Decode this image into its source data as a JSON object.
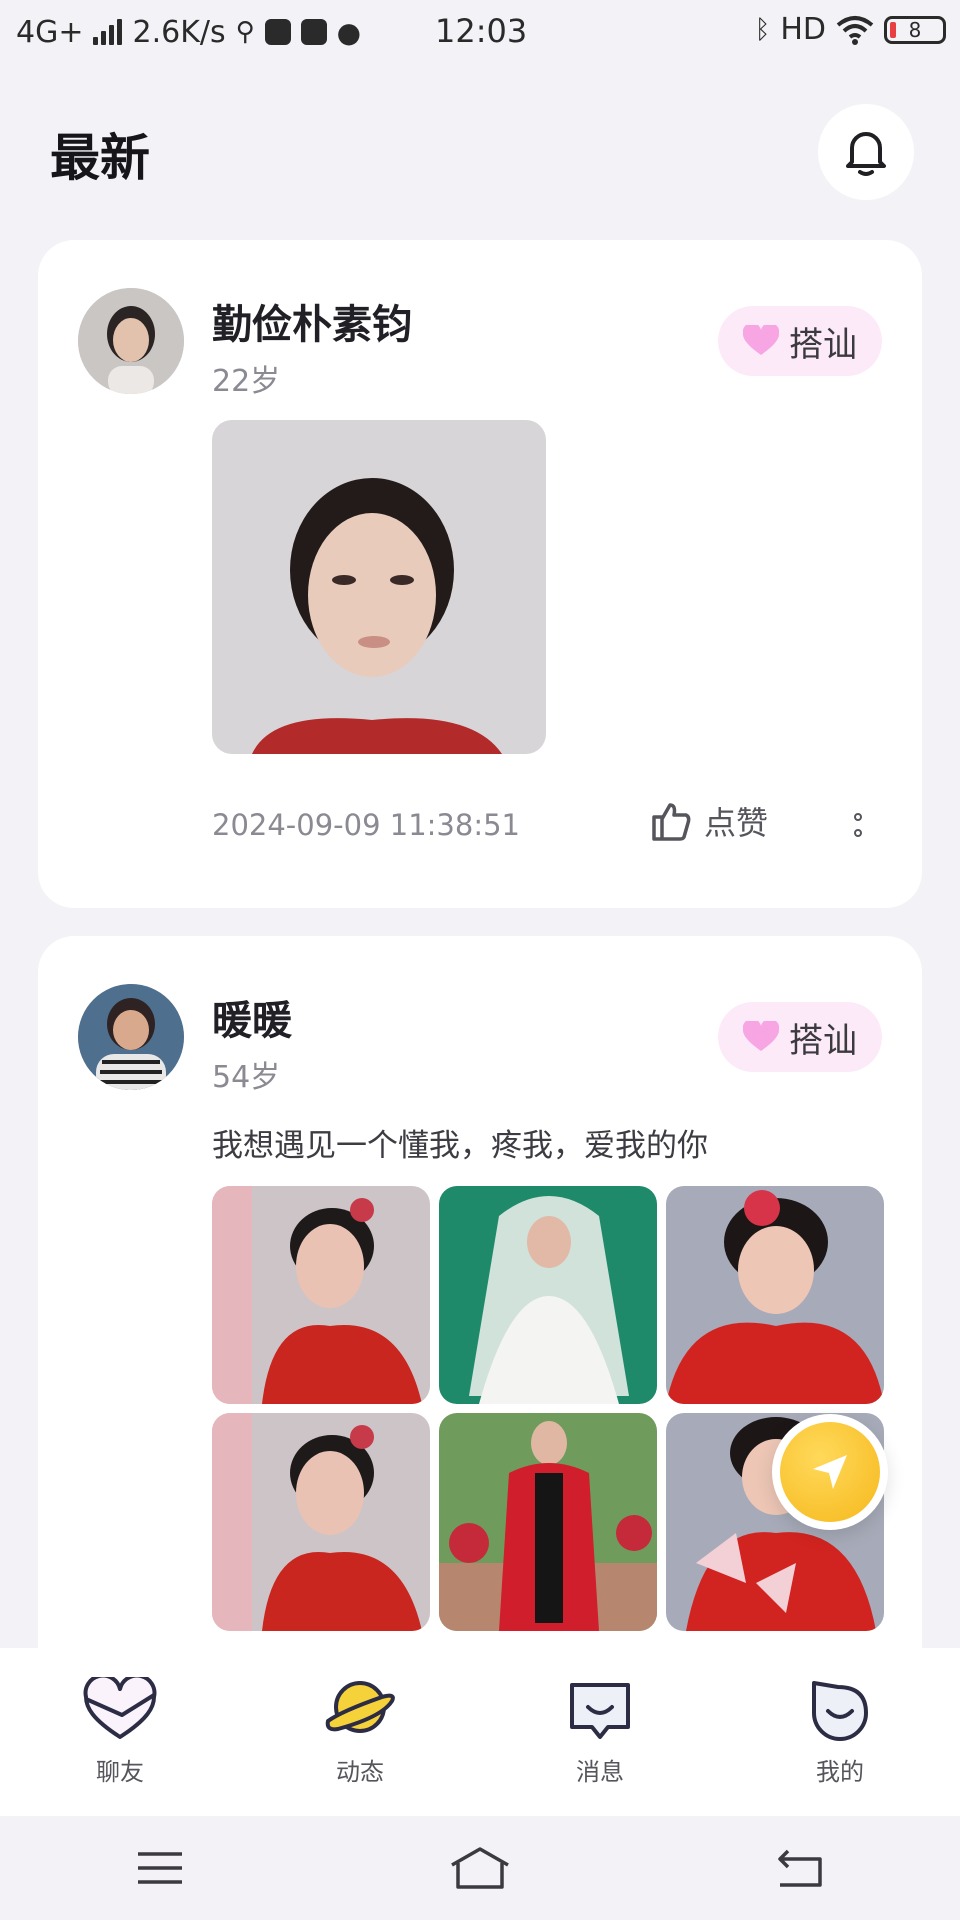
{
  "status_bar": {
    "network": "4G+",
    "speed": "2.6K/s",
    "time": "12:03",
    "hd": "HD",
    "battery": "8"
  },
  "header": {
    "title": "最新"
  },
  "posts": [
    {
      "username": "勤俭朴素钧",
      "age": "22岁",
      "greet_label": "搭讪",
      "text": "",
      "time": "2024-09-09 11:38:51",
      "like_label": "点赞"
    },
    {
      "username": "暖暖",
      "age": "54岁",
      "greet_label": "搭讪",
      "text": "我想遇见一个懂我，疼我，爱我的你"
    }
  ],
  "bottom_nav": {
    "items": [
      {
        "label": "聊友",
        "icon": "heart-chat-icon"
      },
      {
        "label": "动态",
        "icon": "planet-icon",
        "active": true
      },
      {
        "label": "消息",
        "icon": "message-face-icon"
      },
      {
        "label": "我的",
        "icon": "profile-face-icon"
      }
    ]
  },
  "colors": {
    "background": "#f3f3f7",
    "greet_pill": "#fdeaf8",
    "heart_pink": "#f7a5e3",
    "fab_yellow": "#f6b81c",
    "active_nav": "#f5d23a"
  }
}
